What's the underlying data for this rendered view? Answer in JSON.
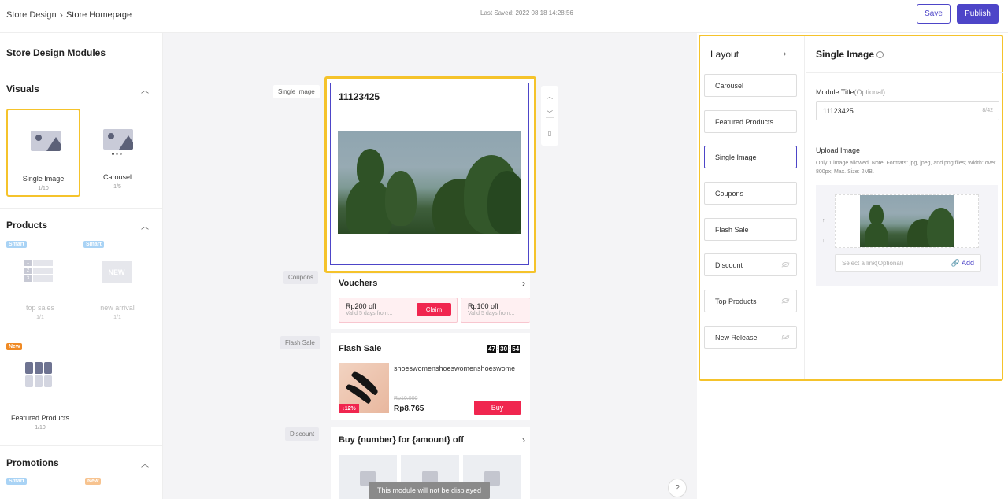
{
  "header": {
    "breadcrumb_root": "Store Design",
    "breadcrumb_sep": "›",
    "breadcrumb_current": "Store Homepage",
    "last_saved": "Last Saved: 2022 08 18 14:28:56",
    "save_label": "Save",
    "publish_label": "Publish"
  },
  "left": {
    "title": "Store Design Modules",
    "visuals": {
      "heading": "Visuals",
      "items": [
        {
          "label": "Single Image",
          "count": "1/10"
        },
        {
          "label": "Carousel",
          "count": "1/5"
        }
      ]
    },
    "products": {
      "heading": "Products",
      "items": [
        {
          "badge": "Smart",
          "label": "top sales",
          "count": "1/1"
        },
        {
          "badge": "Smart",
          "label": "new arrival",
          "count": "1/1",
          "thumb_text": "NEW"
        },
        {
          "badge": "New",
          "label": "Featured Products",
          "count": "1/10"
        }
      ],
      "rank_numbers": [
        "1",
        "2",
        "3"
      ]
    },
    "promotions": {
      "heading": "Promotions",
      "badges": [
        "Smart",
        "New"
      ]
    }
  },
  "canvas": {
    "labels": {
      "single_image": "Single Image",
      "coupons": "Coupons",
      "flash_sale": "Flash Sale",
      "discount": "Discount"
    },
    "single_image_title": "11123425",
    "controls": {
      "up": "⌃",
      "down": "⌄",
      "delete": "🗑"
    },
    "vouchers": {
      "heading": "Vouchers",
      "items": [
        {
          "amount": "Rp200 off",
          "valid": "Valid 5 days from...",
          "claim": "Claim"
        },
        {
          "amount": "Rp100 off",
          "valid": "Valid 5 days from..."
        }
      ]
    },
    "flash_sale": {
      "heading": "Flash Sale",
      "timer": [
        "47",
        "30",
        "54"
      ],
      "product_name": "shoeswomenshoeswomenshoeswome",
      "old_price": "Rp10.000",
      "price": "Rp8.765",
      "discount": "12%",
      "buy": "Buy"
    },
    "discount_card": {
      "heading": "Buy {number} for {amount} off"
    },
    "toast": "This module will not be displayed",
    "help": "?"
  },
  "right": {
    "layout": {
      "heading": "Layout",
      "items": [
        {
          "label": "Carousel",
          "hidden": false
        },
        {
          "label": "Featured Products",
          "hidden": false
        },
        {
          "label": "Single Image",
          "hidden": false,
          "active": true
        },
        {
          "label": "Coupons",
          "hidden": false
        },
        {
          "label": "Flash Sale",
          "hidden": false
        },
        {
          "label": "Discount",
          "hidden": true
        },
        {
          "label": "Top Products",
          "hidden": true
        },
        {
          "label": "New Release",
          "hidden": true
        }
      ]
    },
    "detail": {
      "heading": "Single Image",
      "module_title_label": "Module Title",
      "module_title_optional": "(Optional)",
      "module_title_value": "11123425",
      "module_title_count": "8/42",
      "upload_label": "Upload Image",
      "upload_note": "Only 1 image allowed. Note: Formats: jpg, jpeg, and png files; Width: over 800px; Max. Size: 2MB.",
      "link_placeholder": "Select a link(Optional)",
      "add_label": "Add"
    }
  },
  "colors": {
    "accent": "#4d45c8",
    "highlight": "#f5c32b",
    "sale": "#f0264f"
  }
}
